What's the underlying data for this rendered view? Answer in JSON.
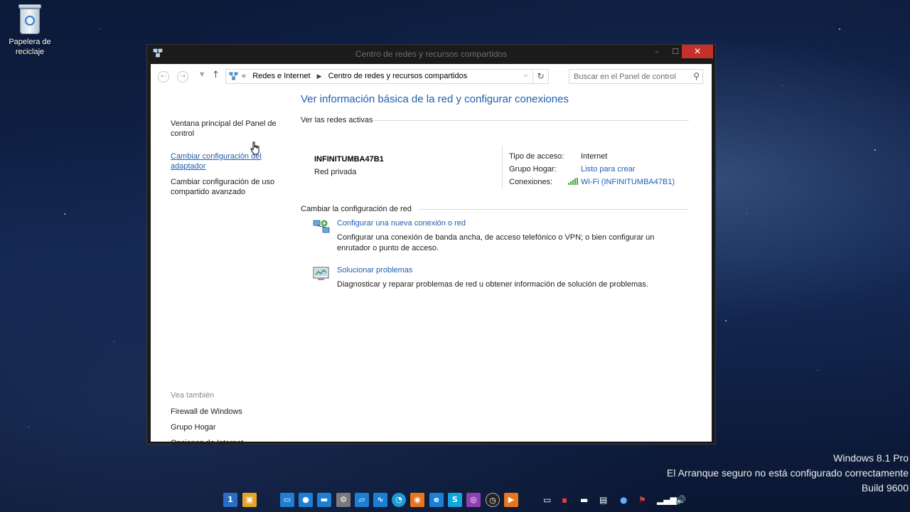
{
  "desktop": {
    "recycle_bin_label": "Papelera de reciclaje"
  },
  "window": {
    "title": "Centro de redes y recursos compartidos",
    "minimize": "–",
    "maximize": "☐",
    "close": "✕"
  },
  "address_bar": {
    "crumb_prefix": "«",
    "crumbs": [
      "Redes e Internet",
      "Centro de redes y recursos compartidos"
    ],
    "search_placeholder": "Buscar en el Panel de control"
  },
  "left_pane": {
    "links": [
      "Ventana principal del Panel de control",
      "Cambiar configuración del adaptador",
      "Cambiar configuración de uso compartido avanzado"
    ],
    "see_also_header": "Vea también",
    "see_also": [
      "Firewall de Windows",
      "Grupo Hogar",
      "Opciones de Internet"
    ]
  },
  "main": {
    "title": "Ver información básica de la red y configurar conexiones",
    "active_networks_header": "Ver las redes activas",
    "network": {
      "name": "INFINITUMBA47B1",
      "type": "Red privada",
      "access_type_label": "Tipo de acceso:",
      "access_type_value": "Internet",
      "homegroup_label": "Grupo Hogar:",
      "homegroup_value": "Listo para crear",
      "connections_label": "Conexiones:",
      "connections_value": "Wi-Fi (INFINITUMBA47B1)"
    },
    "change_settings_header": "Cambiar la configuración de red",
    "tasks": [
      {
        "link": "Configurar una nueva conexión o red",
        "description": "Configurar una conexión de banda ancha, de acceso telefónico o VPN; o bien configurar un enrutador o punto de acceso."
      },
      {
        "link": "Solucionar problemas",
        "description": "Diagnosticar y reparar problemas de red u obtener información de solución de problemas."
      }
    ]
  },
  "watermark": {
    "line1": "Windows 8.1 Pro",
    "line2": "El Arranque seguro no está configurado correctamente",
    "line3": "Build 9600"
  },
  "colors": {
    "link": "#1f5eb0",
    "close_button": "#c7302a",
    "window_frame": "#1b1b1b"
  }
}
